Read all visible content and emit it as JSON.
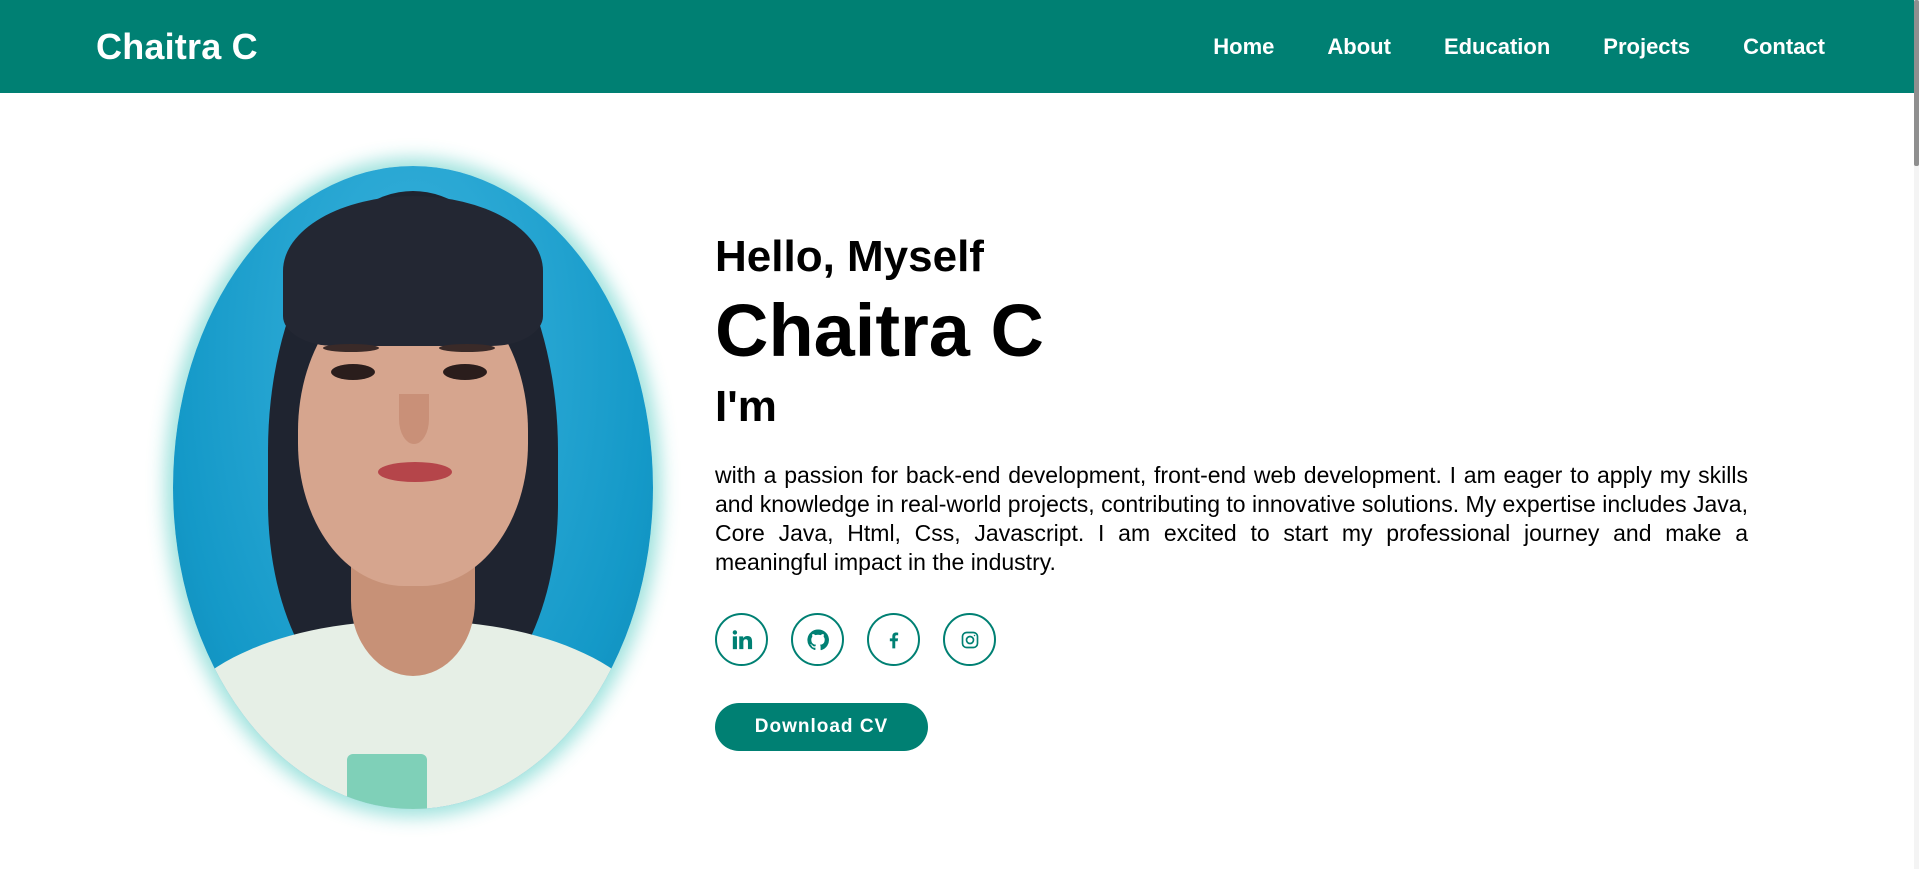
{
  "header": {
    "brand": "Chaitra C",
    "nav": [
      {
        "label": "Home"
      },
      {
        "label": "About"
      },
      {
        "label": "Education"
      },
      {
        "label": "Projects"
      },
      {
        "label": "Contact"
      }
    ]
  },
  "hero": {
    "greeting": "Hello, Myself",
    "name": "Chaitra C",
    "role_prefix": "I'm",
    "bio": "with a passion for back-end development, front-end web development. I am eager to apply my skills and knowledge in real-world projects, contributing to innovative solutions. My expertise includes Java, Core Java, Html, Css, Javascript. I am excited to start my professional journey and make a meaningful impact in the industry.",
    "socials": [
      {
        "icon": "linkedin-icon"
      },
      {
        "icon": "github-icon"
      },
      {
        "icon": "facebook-icon"
      },
      {
        "icon": "instagram-icon"
      }
    ],
    "cta_label": "Download CV"
  },
  "theme": {
    "accent": "#008073",
    "header_bg": "#008073",
    "text": "#000000",
    "background": "#ffffff"
  }
}
